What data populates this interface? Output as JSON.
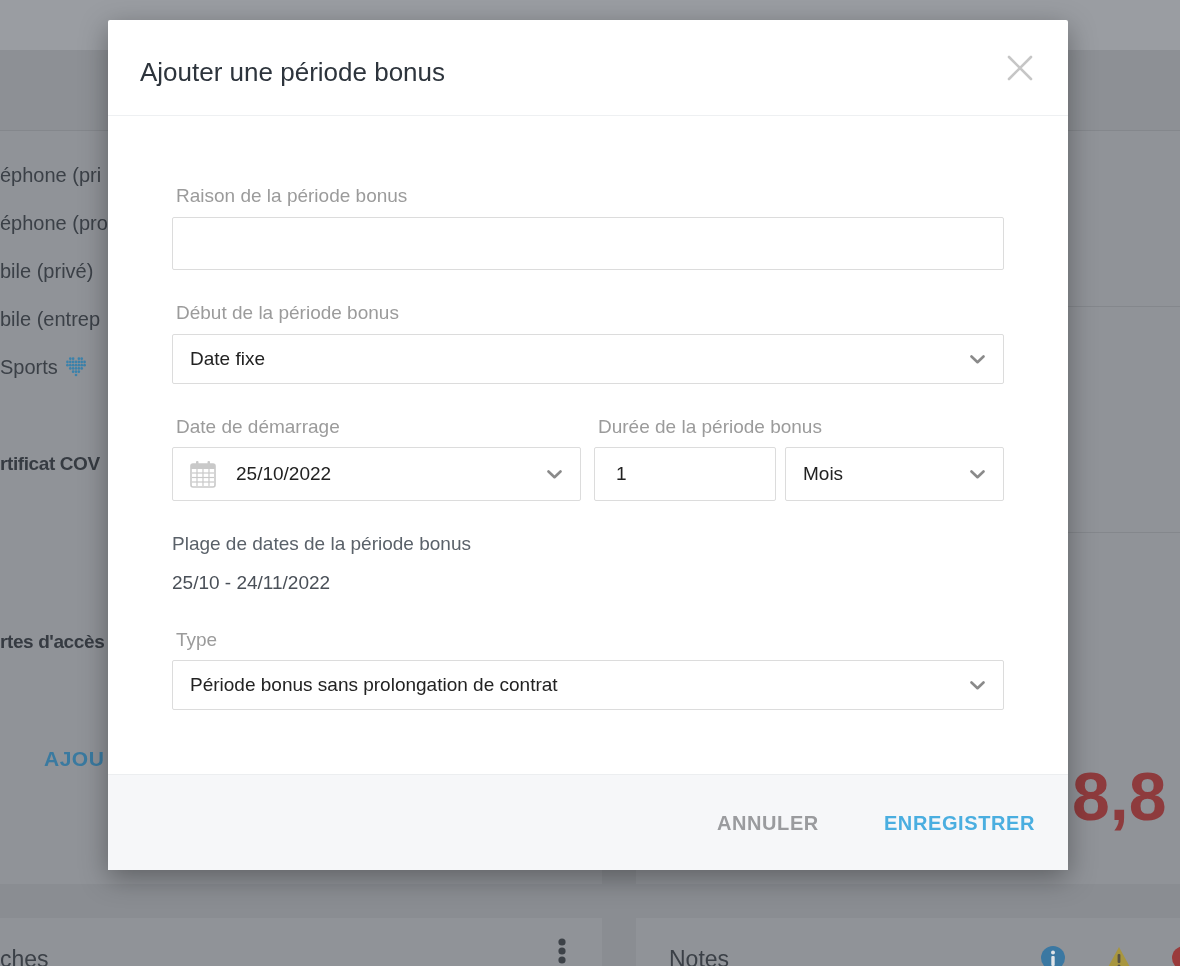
{
  "page": {
    "left_card": {
      "rows": [
        {
          "label": "éphone (pri",
          "kind": "plain"
        },
        {
          "label": "éphone (pro",
          "kind": "plain"
        },
        {
          "label": "bile (privé)",
          "kind": "plain"
        },
        {
          "label": "bile (entrep",
          "kind": "plain"
        },
        {
          "label": "Sports",
          "kind": "heart"
        }
      ],
      "sections": [
        {
          "heading": "rtificat COV"
        },
        {
          "heading": "rtes d'accès"
        }
      ],
      "link": "AJOU"
    },
    "right_card": {
      "amount": "8,8"
    },
    "bottom_cards": [
      {
        "title": "ches",
        "kind": "menu"
      },
      {
        "title": "Notes",
        "kind": "notes"
      }
    ]
  },
  "dialog": {
    "title": "Ajouter une période bonus",
    "reason": {
      "label": "Raison de la période bonus"
    },
    "start": {
      "label": "Début de la période bonus",
      "value": "Date fixe"
    },
    "start_date": {
      "label": "Date de démarrage",
      "value": "25/10/2022"
    },
    "duration": {
      "label": "Durée de la période bonus",
      "amount": "1",
      "unit": "Mois"
    },
    "range": {
      "label": "Plage de dates de la période bonus",
      "value": "25/10 - 24/11/2022"
    },
    "type": {
      "label": "Type",
      "value": "Période bonus sans prolongation de contrat"
    },
    "buttons": [
      {
        "label": "ANNULER",
        "kind": "secondary"
      },
      {
        "label": "ENREGISTRER",
        "kind": "primary"
      }
    ]
  }
}
